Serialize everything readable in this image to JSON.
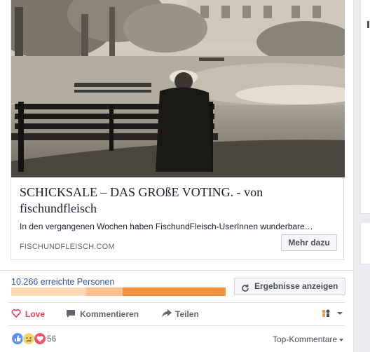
{
  "link_preview": {
    "title": "SCHICKSALE – DAS GROßE VOTING. - von fischundfleisch",
    "description": "In den vergangenen Wochen haben FischundFleisch-UserInnen wunderbare…",
    "domain": "FISCHUNDFLEISCH.COM",
    "button_label": "Mehr dazu",
    "image_icon": "park-bench-photo"
  },
  "insights": {
    "reach_label": "10.266 erreichte Personen",
    "results_button": "Ergebnisse anzeigen",
    "organic_fraction": 0.52,
    "organic_fraction_light": 0.35
  },
  "actions": {
    "love": "Love",
    "comment": "Kommentieren",
    "share": "Teilen"
  },
  "reactions": {
    "icons": [
      "like-reaction-icon",
      "sad-reaction-icon",
      "love-reaction-icon"
    ],
    "count": "56"
  },
  "comments": {
    "order_label": "Top-Kommentare"
  },
  "colors": {
    "link": "#365899",
    "love": "#f33e58",
    "reach_bar": "#f7923b",
    "reach_fill": "#ffc18a"
  }
}
